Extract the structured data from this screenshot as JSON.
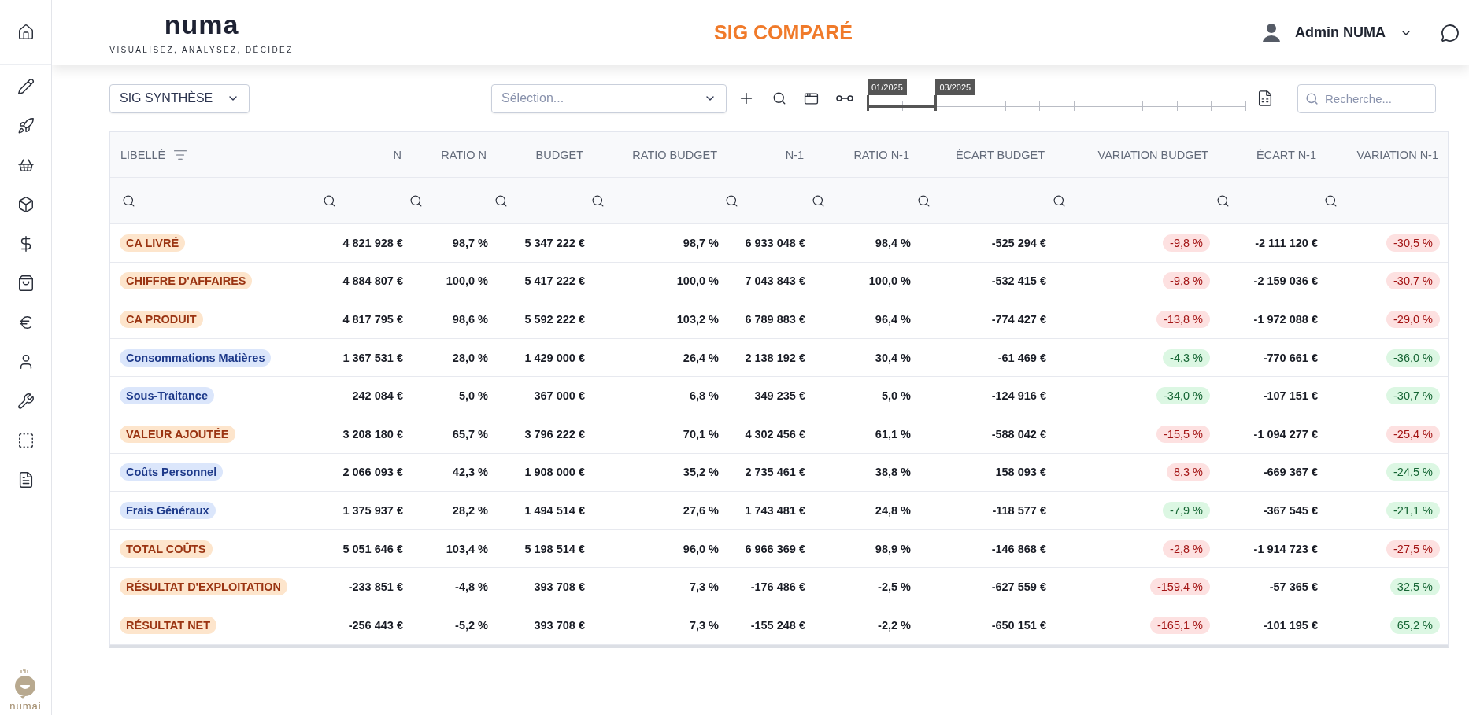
{
  "header": {
    "logo": "numa",
    "tagline": "VISUALISEZ, ANALYSEZ, DÉCIDEZ",
    "title": "SIG COMPARÉ",
    "user": "Admin NUMA"
  },
  "sidebar": {
    "logo": "numai"
  },
  "toolbar": {
    "view_select": "SIG SYNTHÈSE",
    "selection_placeholder": "Sélection...",
    "search_placeholder": "Recherche...",
    "period": [
      {
        "label": "01/2025",
        "level": 0
      },
      {
        "label": "03/2025",
        "level": 0.18
      }
    ]
  },
  "table": {
    "columns": [
      "LIBELLÉ",
      "N",
      "RATIO N",
      "BUDGET",
      "RATIO BUDGET",
      "N-1",
      "RATIO N-1",
      "ÉCART BUDGET",
      "VARIATION BUDGET",
      "ÉCART N-1",
      "VARIATION N-1"
    ],
    "rows": [
      {
        "label": "CA LIVRÉ",
        "kind": "total",
        "n": "4 821 928 €",
        "ratio_n": "98,7 %",
        "budget": "5 347 222 €",
        "ratio_budget": "98,7 %",
        "n1": "6 933 048 €",
        "ratio_n1": "98,4 %",
        "ecart_budget": "-525 294 €",
        "variation_budget": {
          "text": "-9,8 %",
          "color": "#fde1e1"
        },
        "ecart_n1": "-2 111 120 €",
        "variation_n1": {
          "text": "-30,5 %",
          "color": "#fde1e1"
        }
      },
      {
        "label": "CHIFFRE D'AFFAIRES",
        "kind": "total",
        "n": "4 884 807 €",
        "ratio_n": "100,0 %",
        "budget": "5 417 222 €",
        "ratio_budget": "100,0 %",
        "n1": "7 043 843 €",
        "ratio_n1": "100,0 %",
        "ecart_budget": "-532 415 €",
        "variation_budget": {
          "text": "-9,8 %",
          "color": "#fde1e1"
        },
        "ecart_n1": "-2 159 036 €",
        "variation_n1": {
          "text": "-30,7 %",
          "color": "#fde1e1"
        }
      },
      {
        "label": "CA PRODUIT",
        "kind": "total",
        "n": "4 817 795 €",
        "ratio_n": "98,6 %",
        "budget": "5 592 222 €",
        "ratio_budget": "103,2 %",
        "n1": "6 789 883 €",
        "ratio_n1": "96,4 %",
        "ecart_budget": "-774 427 €",
        "variation_budget": {
          "text": "-13,8 %",
          "color": "#fde1e1"
        },
        "ecart_n1": "-1 972 088 €",
        "variation_n1": {
          "text": "-29,0 %",
          "color": "#fde1e1"
        }
      },
      {
        "label": "Consommations Matières",
        "kind": "detail",
        "n": "1 367 531 €",
        "ratio_n": "28,0 %",
        "budget": "1 429 000 €",
        "ratio_budget": "26,4 %",
        "n1": "2 138 192 €",
        "ratio_n1": "30,4 %",
        "ecart_budget": "-61 469 €",
        "variation_budget": {
          "text": "-4,3 %",
          "color": "#dcf7e3"
        },
        "ecart_n1": "-770 661 €",
        "variation_n1": {
          "text": "-36,0 %",
          "color": "#dcf7e3"
        }
      },
      {
        "label": "Sous-Traitance",
        "kind": "detail",
        "n": "242 084 €",
        "ratio_n": "5,0 %",
        "budget": "367 000 €",
        "ratio_budget": "6,8 %",
        "n1": "349 235 €",
        "ratio_n1": "5,0 %",
        "ecart_budget": "-124 916 €",
        "variation_budget": {
          "text": "-34,0 %",
          "color": "#dcf7e3"
        },
        "ecart_n1": "-107 151 €",
        "variation_n1": {
          "text": "-30,7 %",
          "color": "#dcf7e3"
        }
      },
      {
        "label": "VALEUR AJOUTÉE",
        "kind": "total",
        "n": "3 208 180 €",
        "ratio_n": "65,7 %",
        "budget": "3 796 222 €",
        "ratio_budget": "70,1 %",
        "n1": "4 302 456 €",
        "ratio_n1": "61,1 %",
        "ecart_budget": "-588 042 €",
        "variation_budget": {
          "text": "-15,5 %",
          "color": "#fde1e1"
        },
        "ecart_n1": "-1 094 277 €",
        "variation_n1": {
          "text": "-25,4 %",
          "color": "#fde1e1"
        }
      },
      {
        "label": "Coûts Personnel",
        "kind": "detail",
        "n": "2 066 093 €",
        "ratio_n": "42,3 %",
        "budget": "1 908 000 €",
        "ratio_budget": "35,2 %",
        "n1": "2 735 461 €",
        "ratio_n1": "38,8 %",
        "ecart_budget": "158 093 €",
        "variation_budget": {
          "text": "8,3 %",
          "color": "#fde1e1"
        },
        "ecart_n1": "-669 367 €",
        "variation_n1": {
          "text": "-24,5 %",
          "color": "#dcf7e3"
        }
      },
      {
        "label": "Frais Généraux",
        "kind": "detail",
        "n": "1 375 937 €",
        "ratio_n": "28,2 %",
        "budget": "1 494 514 €",
        "ratio_budget": "27,6 %",
        "n1": "1 743 481 €",
        "ratio_n1": "24,8 %",
        "ecart_budget": "-118 577 €",
        "variation_budget": {
          "text": "-7,9 %",
          "color": "#dcf7e3"
        },
        "ecart_n1": "-367 545 €",
        "variation_n1": {
          "text": "-21,1 %",
          "color": "#dcf7e3"
        }
      },
      {
        "label": "TOTAL COÛTS",
        "kind": "total",
        "n": "5 051 646 €",
        "ratio_n": "103,4 %",
        "budget": "5 198 514 €",
        "ratio_budget": "96,0 %",
        "n1": "6 966 369 €",
        "ratio_n1": "98,9 %",
        "ecart_budget": "-146 868 €",
        "variation_budget": {
          "text": "-2,8 %",
          "color": "#fde1e1"
        },
        "ecart_n1": "-1 914 723 €",
        "variation_n1": {
          "text": "-27,5 %",
          "color": "#fde1e1"
        }
      },
      {
        "label": "RÉSULTAT D'EXPLOITATION",
        "kind": "total",
        "n": "-233 851 €",
        "ratio_n": "-4,8 %",
        "budget": "393 708 €",
        "ratio_budget": "7,3 %",
        "n1": "-176 486 €",
        "ratio_n1": "-2,5 %",
        "ecart_budget": "-627 559 €",
        "variation_budget": {
          "text": "-159,4 %",
          "color": "#fde1e1"
        },
        "ecart_n1": "-57 365 €",
        "variation_n1": {
          "text": "32,5 %",
          "color": "#dcf7e3"
        }
      },
      {
        "label": "RÉSULTAT NET",
        "kind": "total",
        "n": "-256 443 €",
        "ratio_n": "-5,2 %",
        "budget": "393 708 €",
        "ratio_budget": "7,3 %",
        "n1": "-155 248 €",
        "ratio_n1": "-2,2 %",
        "ecart_budget": "-650 151 €",
        "variation_budget": {
          "text": "-165,1 %",
          "color": "#fde1e1"
        },
        "ecart_n1": "-101 195 €",
        "variation_n1": {
          "text": "65,2 %",
          "color": "#dcf7e3"
        }
      }
    ]
  }
}
